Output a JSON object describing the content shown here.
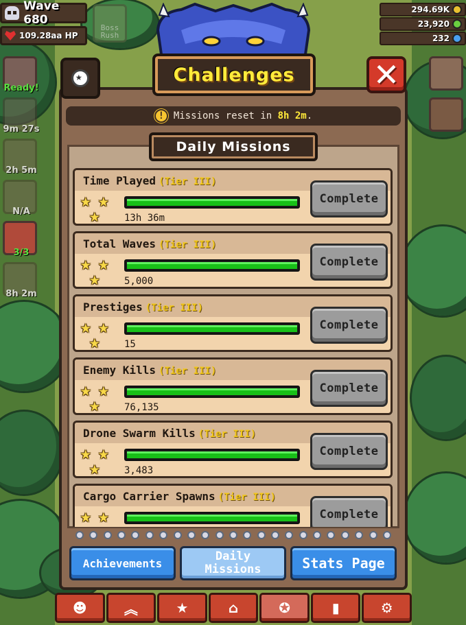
{
  "hud": {
    "wave": "Wave 680",
    "hp": "109.28aa HP",
    "boss_label": "Boss Rush"
  },
  "skills": [
    {
      "label": "Ready!",
      "state": "ready"
    },
    {
      "label": "9m 27s",
      "state": "cooldown"
    },
    {
      "label": "2h 5m",
      "state": "cooldown"
    },
    {
      "label": "N/A",
      "state": "unavailable"
    },
    {
      "label": "3/3",
      "state": "charges"
    },
    {
      "label": "8h 2m",
      "state": "cooldown"
    }
  ],
  "currency": [
    {
      "value": "294.69K",
      "icon": "coin-icon",
      "color": "#e8c030"
    },
    {
      "value": "23,920",
      "icon": "gem-icon",
      "color": "#6ad040"
    },
    {
      "value": "232",
      "icon": "crystal-icon",
      "color": "#4aa0f0"
    }
  ],
  "modal": {
    "title": "Challenges",
    "close_label": "✕",
    "reset_text": "Missions reset in",
    "reset_time": "8h 2m",
    "reset_suffix": ".",
    "section_title": "Daily Missions"
  },
  "missions": [
    {
      "name": "Time Played",
      "tier": "(Tier III)",
      "value": "13h 36m",
      "progress": 1.0,
      "stars": 3,
      "button": "Complete"
    },
    {
      "name": "Total Waves",
      "tier": "(Tier III)",
      "value": "5,000",
      "progress": 1.0,
      "stars": 3,
      "button": "Complete"
    },
    {
      "name": "Prestiges",
      "tier": "(Tier III)",
      "value": "15",
      "progress": 1.0,
      "stars": 3,
      "button": "Complete"
    },
    {
      "name": "Enemy Kills",
      "tier": "(Tier III)",
      "value": "76,135",
      "progress": 1.0,
      "stars": 3,
      "button": "Complete"
    },
    {
      "name": "Drone Swarm Kills",
      "tier": "(Tier III)",
      "value": "3,483",
      "progress": 1.0,
      "stars": 3,
      "button": "Complete"
    },
    {
      "name": "Cargo Carrier Spawns",
      "tier": "(Tier III)",
      "value": "",
      "progress": 1.0,
      "stars": 3,
      "button": "Complete"
    }
  ],
  "tabs": {
    "achievements": "Achievements",
    "daily_line1": "Daily",
    "daily_line2": "Missions",
    "stats": "Stats Page",
    "active": "daily"
  },
  "nav": [
    {
      "icon": "monster-icon",
      "glyph": "☻"
    },
    {
      "icon": "upgrade-chevrons-icon",
      "glyph": "︽"
    },
    {
      "icon": "sparkle-stars-icon",
      "glyph": "★"
    },
    {
      "icon": "shop-icon",
      "glyph": "⌂"
    },
    {
      "icon": "medal-icon",
      "glyph": "✪",
      "selected": true
    },
    {
      "icon": "stats-bars-icon",
      "glyph": "▮"
    },
    {
      "icon": "settings-gear-icon",
      "glyph": "⚙"
    }
  ]
}
